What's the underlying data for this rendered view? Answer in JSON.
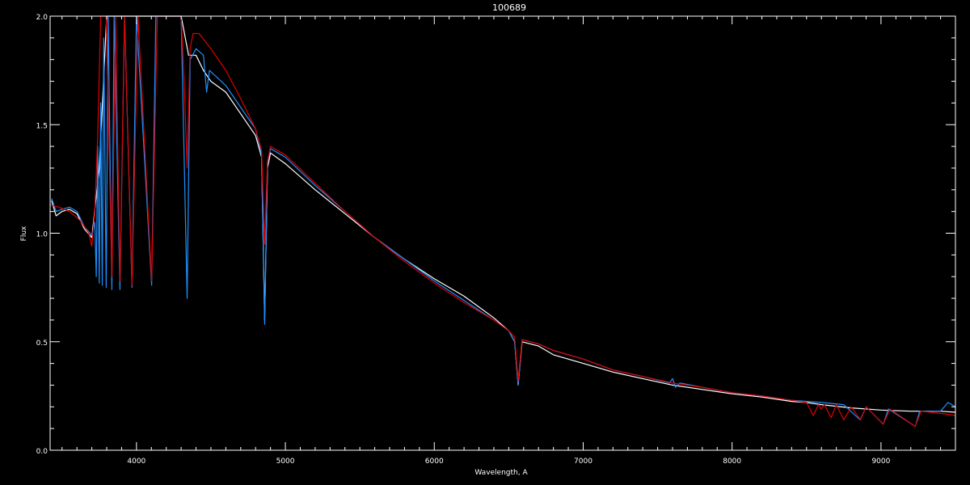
{
  "chart_data": {
    "type": "line",
    "title": "100689",
    "xlabel": "Wavelength, A",
    "ylabel": "Flux",
    "xlim": [
      3420,
      9500
    ],
    "ylim": [
      0.0,
      2.0
    ],
    "x_ticks": [
      4000,
      5000,
      6000,
      7000,
      8000,
      9000
    ],
    "x_tick_labels": [
      "4000",
      "5000",
      "6000",
      "7000",
      "8000",
      "9000"
    ],
    "y_ticks": [
      0.0,
      0.5,
      1.0,
      1.5,
      2.0
    ],
    "y_tick_labels": [
      "0.0",
      "0.5",
      "1.0",
      "1.5",
      "2.0"
    ],
    "grid": false,
    "background": "#000000",
    "series": [
      {
        "color": "#ffffff",
        "points": [
          [
            3430,
            1.15
          ],
          [
            3460,
            1.08
          ],
          [
            3500,
            1.1
          ],
          [
            3550,
            1.11
          ],
          [
            3600,
            1.09
          ],
          [
            3650,
            1.02
          ],
          [
            3700,
            0.98
          ],
          [
            3750,
            1.3
          ],
          [
            3800,
            2.0
          ],
          [
            4300,
            2.0
          ],
          [
            4350,
            1.82
          ],
          [
            4400,
            1.82
          ],
          [
            4450,
            1.75
          ],
          [
            4500,
            1.7
          ],
          [
            4600,
            1.65
          ],
          [
            4700,
            1.55
          ],
          [
            4800,
            1.45
          ],
          [
            4840,
            1.35
          ],
          [
            4861,
            0.6
          ],
          [
            4880,
            1.3
          ],
          [
            4900,
            1.37
          ],
          [
            5000,
            1.32
          ],
          [
            5200,
            1.2
          ],
          [
            5400,
            1.09
          ],
          [
            5600,
            0.98
          ],
          [
            5800,
            0.88
          ],
          [
            6000,
            0.79
          ],
          [
            6200,
            0.71
          ],
          [
            6400,
            0.61
          ],
          [
            6500,
            0.55
          ],
          [
            6540,
            0.5
          ],
          [
            6563,
            0.3
          ],
          [
            6590,
            0.5
          ],
          [
            6700,
            0.48
          ],
          [
            6800,
            0.44
          ],
          [
            7000,
            0.4
          ],
          [
            7200,
            0.36
          ],
          [
            7400,
            0.33
          ],
          [
            7600,
            0.3
          ],
          [
            7800,
            0.28
          ],
          [
            8000,
            0.26
          ],
          [
            8200,
            0.245
          ],
          [
            8400,
            0.225
          ],
          [
            8500,
            0.22
          ],
          [
            8600,
            0.21
          ],
          [
            8800,
            0.195
          ],
          [
            9000,
            0.185
          ],
          [
            9200,
            0.18
          ],
          [
            9400,
            0.18
          ],
          [
            9500,
            0.175
          ]
        ]
      },
      {
        "color": "#1e90ff",
        "points": [
          [
            3430,
            1.16
          ],
          [
            3460,
            1.1
          ],
          [
            3500,
            1.11
          ],
          [
            3550,
            1.12
          ],
          [
            3600,
            1.1
          ],
          [
            3650,
            1.03
          ],
          [
            3700,
            0.99
          ],
          [
            3720,
            1.05
          ],
          [
            3730,
            0.8
          ],
          [
            3740,
            1.4
          ],
          [
            3750,
            0.77
          ],
          [
            3760,
            1.6
          ],
          [
            3770,
            0.76
          ],
          [
            3780,
            1.9
          ],
          [
            3797,
            0.75
          ],
          [
            3810,
            2.0
          ],
          [
            3835,
            0.74
          ],
          [
            3850,
            2.0
          ],
          [
            3889,
            0.74
          ],
          [
            3920,
            2.0
          ],
          [
            3970,
            0.75
          ],
          [
            4000,
            2.0
          ],
          [
            4102,
            0.76
          ],
          [
            4130,
            2.0
          ],
          [
            4300,
            2.0
          ],
          [
            4340,
            0.7
          ],
          [
            4360,
            1.8
          ],
          [
            4400,
            1.85
          ],
          [
            4450,
            1.82
          ],
          [
            4471,
            1.65
          ],
          [
            4490,
            1.75
          ],
          [
            4600,
            1.68
          ],
          [
            4700,
            1.58
          ],
          [
            4800,
            1.48
          ],
          [
            4840,
            1.36
          ],
          [
            4861,
            0.58
          ],
          [
            4880,
            1.32
          ],
          [
            4900,
            1.39
          ],
          [
            5000,
            1.35
          ],
          [
            5200,
            1.22
          ],
          [
            5400,
            1.1
          ],
          [
            5600,
            0.98
          ],
          [
            5800,
            0.88
          ],
          [
            6000,
            0.78
          ],
          [
            6200,
            0.69
          ],
          [
            6400,
            0.6
          ],
          [
            6500,
            0.55
          ],
          [
            6540,
            0.5
          ],
          [
            6563,
            0.3
          ],
          [
            6590,
            0.51
          ],
          [
            6700,
            0.49
          ],
          [
            6800,
            0.46
          ],
          [
            7000,
            0.42
          ],
          [
            7200,
            0.37
          ],
          [
            7400,
            0.34
          ],
          [
            7580,
            0.31
          ],
          [
            7600,
            0.33
          ],
          [
            7620,
            0.29
          ],
          [
            7650,
            0.31
          ],
          [
            7800,
            0.29
          ],
          [
            8000,
            0.265
          ],
          [
            8200,
            0.25
          ],
          [
            8400,
            0.23
          ],
          [
            8600,
            0.22
          ],
          [
            8750,
            0.21
          ],
          [
            8860,
            0.14
          ],
          [
            8900,
            0.2
          ],
          [
            9015,
            0.12
          ],
          [
            9050,
            0.19
          ],
          [
            9230,
            0.11
          ],
          [
            9260,
            0.18
          ],
          [
            9400,
            0.18
          ],
          [
            9450,
            0.22
          ],
          [
            9500,
            0.2
          ]
        ]
      },
      {
        "color": "#e00000",
        "points": [
          [
            3420,
            1.13
          ],
          [
            3480,
            1.12
          ],
          [
            3550,
            1.1
          ],
          [
            3620,
            1.06
          ],
          [
            3680,
            1.0
          ],
          [
            3700,
            0.94
          ],
          [
            3720,
            1.1
          ],
          [
            3740,
            1.45
          ],
          [
            3760,
            2.0
          ],
          [
            3797,
            2.0
          ],
          [
            3835,
            0.8
          ],
          [
            3860,
            2.0
          ],
          [
            3889,
            0.78
          ],
          [
            3920,
            2.0
          ],
          [
            3970,
            0.76
          ],
          [
            4010,
            2.0
          ],
          [
            4102,
            0.78
          ],
          [
            4140,
            2.0
          ],
          [
            4300,
            2.0
          ],
          [
            4320,
            1.7
          ],
          [
            4340,
            1.3
          ],
          [
            4360,
            1.85
          ],
          [
            4380,
            1.92
          ],
          [
            4420,
            1.92
          ],
          [
            4500,
            1.85
          ],
          [
            4600,
            1.75
          ],
          [
            4700,
            1.62
          ],
          [
            4800,
            1.48
          ],
          [
            4840,
            1.38
          ],
          [
            4861,
            0.95
          ],
          [
            4880,
            1.33
          ],
          [
            4900,
            1.4
          ],
          [
            5000,
            1.36
          ],
          [
            5200,
            1.23
          ],
          [
            5400,
            1.1
          ],
          [
            5600,
            0.98
          ],
          [
            5800,
            0.87
          ],
          [
            6000,
            0.77
          ],
          [
            6200,
            0.68
          ],
          [
            6400,
            0.6
          ],
          [
            6500,
            0.55
          ],
          [
            6540,
            0.52
          ],
          [
            6563,
            0.32
          ],
          [
            6590,
            0.51
          ],
          [
            6700,
            0.49
          ],
          [
            6800,
            0.46
          ],
          [
            7000,
            0.42
          ],
          [
            7200,
            0.37
          ],
          [
            7400,
            0.34
          ],
          [
            7600,
            0.31
          ],
          [
            7800,
            0.29
          ],
          [
            8000,
            0.265
          ],
          [
            8200,
            0.25
          ],
          [
            8400,
            0.23
          ],
          [
            8500,
            0.22
          ],
          [
            8545,
            0.16
          ],
          [
            8580,
            0.21
          ],
          [
            8598,
            0.19
          ],
          [
            8620,
            0.21
          ],
          [
            8665,
            0.15
          ],
          [
            8700,
            0.21
          ],
          [
            8750,
            0.14
          ],
          [
            8800,
            0.2
          ],
          [
            8862,
            0.14
          ],
          [
            8900,
            0.2
          ],
          [
            9015,
            0.12
          ],
          [
            9060,
            0.19
          ],
          [
            9229,
            0.11
          ],
          [
            9270,
            0.18
          ],
          [
            9400,
            0.17
          ],
          [
            9500,
            0.16
          ]
        ]
      }
    ],
    "annotations": []
  }
}
